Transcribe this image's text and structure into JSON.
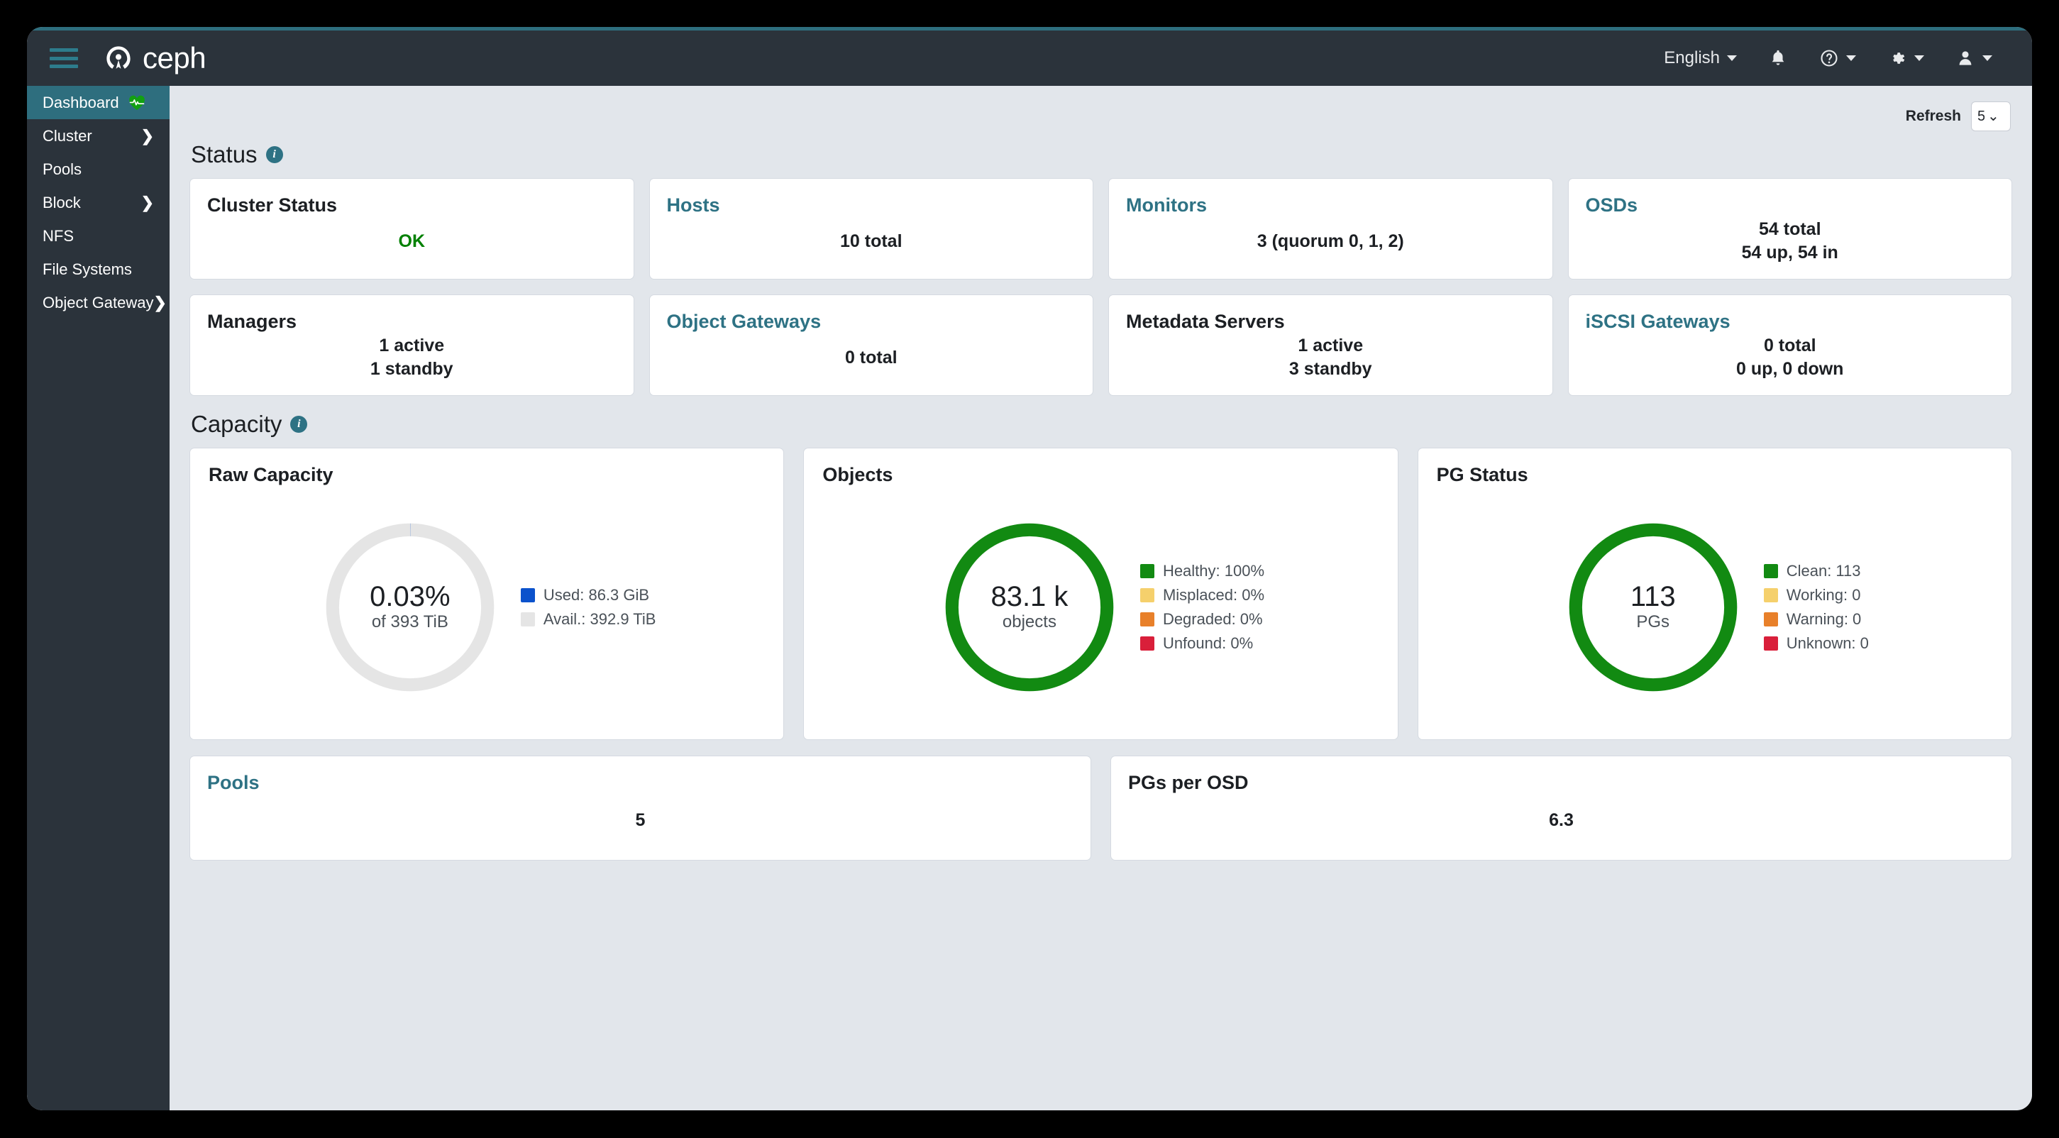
{
  "header": {
    "brand": "ceph",
    "language": "English",
    "icons": [
      "bell-icon",
      "help-icon",
      "gear-icon",
      "user-icon"
    ]
  },
  "sidebar": {
    "items": [
      {
        "label": "Dashboard",
        "active": true,
        "chevron": false,
        "heart": true
      },
      {
        "label": "Cluster",
        "active": false,
        "chevron": true,
        "heart": false
      },
      {
        "label": "Pools",
        "active": false,
        "chevron": false,
        "heart": false
      },
      {
        "label": "Block",
        "active": false,
        "chevron": true,
        "heart": false
      },
      {
        "label": "NFS",
        "active": false,
        "chevron": false,
        "heart": false
      },
      {
        "label": "File Systems",
        "active": false,
        "chevron": false,
        "heart": false
      },
      {
        "label": "Object Gateway",
        "active": false,
        "chevron": true,
        "heart": false
      }
    ]
  },
  "toolbar": {
    "refresh_label": "Refresh",
    "refresh_value": "5",
    "caret": "⌄"
  },
  "sections": {
    "status_title": "Status",
    "capacity_title": "Capacity"
  },
  "status_cards": [
    {
      "title": "Cluster Status",
      "link": false,
      "lines": [
        "OK"
      ],
      "ok": true
    },
    {
      "title": "Hosts",
      "link": true,
      "lines": [
        "10 total"
      ],
      "ok": false
    },
    {
      "title": "Monitors",
      "link": true,
      "lines": [
        "3 (quorum 0, 1, 2)"
      ],
      "ok": false
    },
    {
      "title": "OSDs",
      "link": true,
      "lines": [
        "54 total",
        "54 up, 54 in"
      ],
      "ok": false
    },
    {
      "title": "Managers",
      "link": false,
      "lines": [
        "1 active",
        "1 standby"
      ],
      "ok": false
    },
    {
      "title": "Object Gateways",
      "link": true,
      "lines": [
        "0 total"
      ],
      "ok": false
    },
    {
      "title": "Metadata Servers",
      "link": false,
      "lines": [
        "1 active",
        "3 standby"
      ],
      "ok": false
    },
    {
      "title": "iSCSI Gateways",
      "link": true,
      "lines": [
        "0 total",
        "0 up, 0 down"
      ],
      "ok": false
    }
  ],
  "capacity_cards": [
    {
      "title": "Raw Capacity",
      "center_main": "0.03%",
      "center_sub": "of 393 TiB",
      "ring_color": "#e5e5e5",
      "legend": [
        {
          "label": "Used: 86.3 GiB",
          "color": "#0b52cc"
        },
        {
          "label": "Avail.: 392.9 TiB",
          "color": "#e5e5e5"
        }
      ]
    },
    {
      "title": "Objects",
      "center_main": "83.1 k",
      "center_sub": "objects",
      "ring_color": "#128a12",
      "legend": [
        {
          "label": "Healthy: 100%",
          "color": "#128a12"
        },
        {
          "label": "Misplaced: 0%",
          "color": "#f5d06c"
        },
        {
          "label": "Degraded: 0%",
          "color": "#e8802a"
        },
        {
          "label": "Unfound: 0%",
          "color": "#d91f3a"
        }
      ]
    },
    {
      "title": "PG Status",
      "center_main": "113",
      "center_sub": "PGs",
      "ring_color": "#128a12",
      "legend": [
        {
          "label": "Clean: 113",
          "color": "#128a12"
        },
        {
          "label": "Working: 0",
          "color": "#f5d06c"
        },
        {
          "label": "Warning: 0",
          "color": "#e8802a"
        },
        {
          "label": "Unknown: 0",
          "color": "#d91f3a"
        }
      ]
    }
  ],
  "bottom_cards": [
    {
      "title": "Pools",
      "link": true,
      "value": "5"
    },
    {
      "title": "PGs per OSD",
      "link": false,
      "value": "6.3"
    }
  ],
  "chart_data": [
    {
      "type": "pie",
      "title": "Raw Capacity",
      "categories": [
        "Used",
        "Avail."
      ],
      "values": [
        86.3,
        402201.6
      ],
      "units": "GiB",
      "labels": [
        "Used: 86.3 GiB",
        "Avail.: 392.9 TiB"
      ],
      "center_label": "0.03% of 393 TiB",
      "colors": [
        "#0b52cc",
        "#e5e5e5"
      ],
      "legend_position": "right"
    },
    {
      "type": "pie",
      "title": "Objects",
      "categories": [
        "Healthy",
        "Misplaced",
        "Degraded",
        "Unfound"
      ],
      "values": [
        100,
        0,
        0,
        0
      ],
      "units": "%",
      "labels": [
        "Healthy: 100%",
        "Misplaced: 0%",
        "Degraded: 0%",
        "Unfound: 0%"
      ],
      "center_label": "83.1 k objects",
      "colors": [
        "#128a12",
        "#f5d06c",
        "#e8802a",
        "#d91f3a"
      ],
      "legend_position": "right"
    },
    {
      "type": "pie",
      "title": "PG Status",
      "categories": [
        "Clean",
        "Working",
        "Warning",
        "Unknown"
      ],
      "values": [
        113,
        0,
        0,
        0
      ],
      "units": "PGs",
      "labels": [
        "Clean: 113",
        "Working: 0",
        "Warning: 0",
        "Unknown: 0"
      ],
      "center_label": "113 PGs",
      "colors": [
        "#128a12",
        "#f5d06c",
        "#e8802a",
        "#d91f3a"
      ],
      "legend_position": "right"
    }
  ],
  "colors": {
    "brand_teal": "#2e6e7e",
    "header_dark": "#2b333b",
    "page_bg": "#e2e6eb",
    "ok_green": "#008000"
  }
}
